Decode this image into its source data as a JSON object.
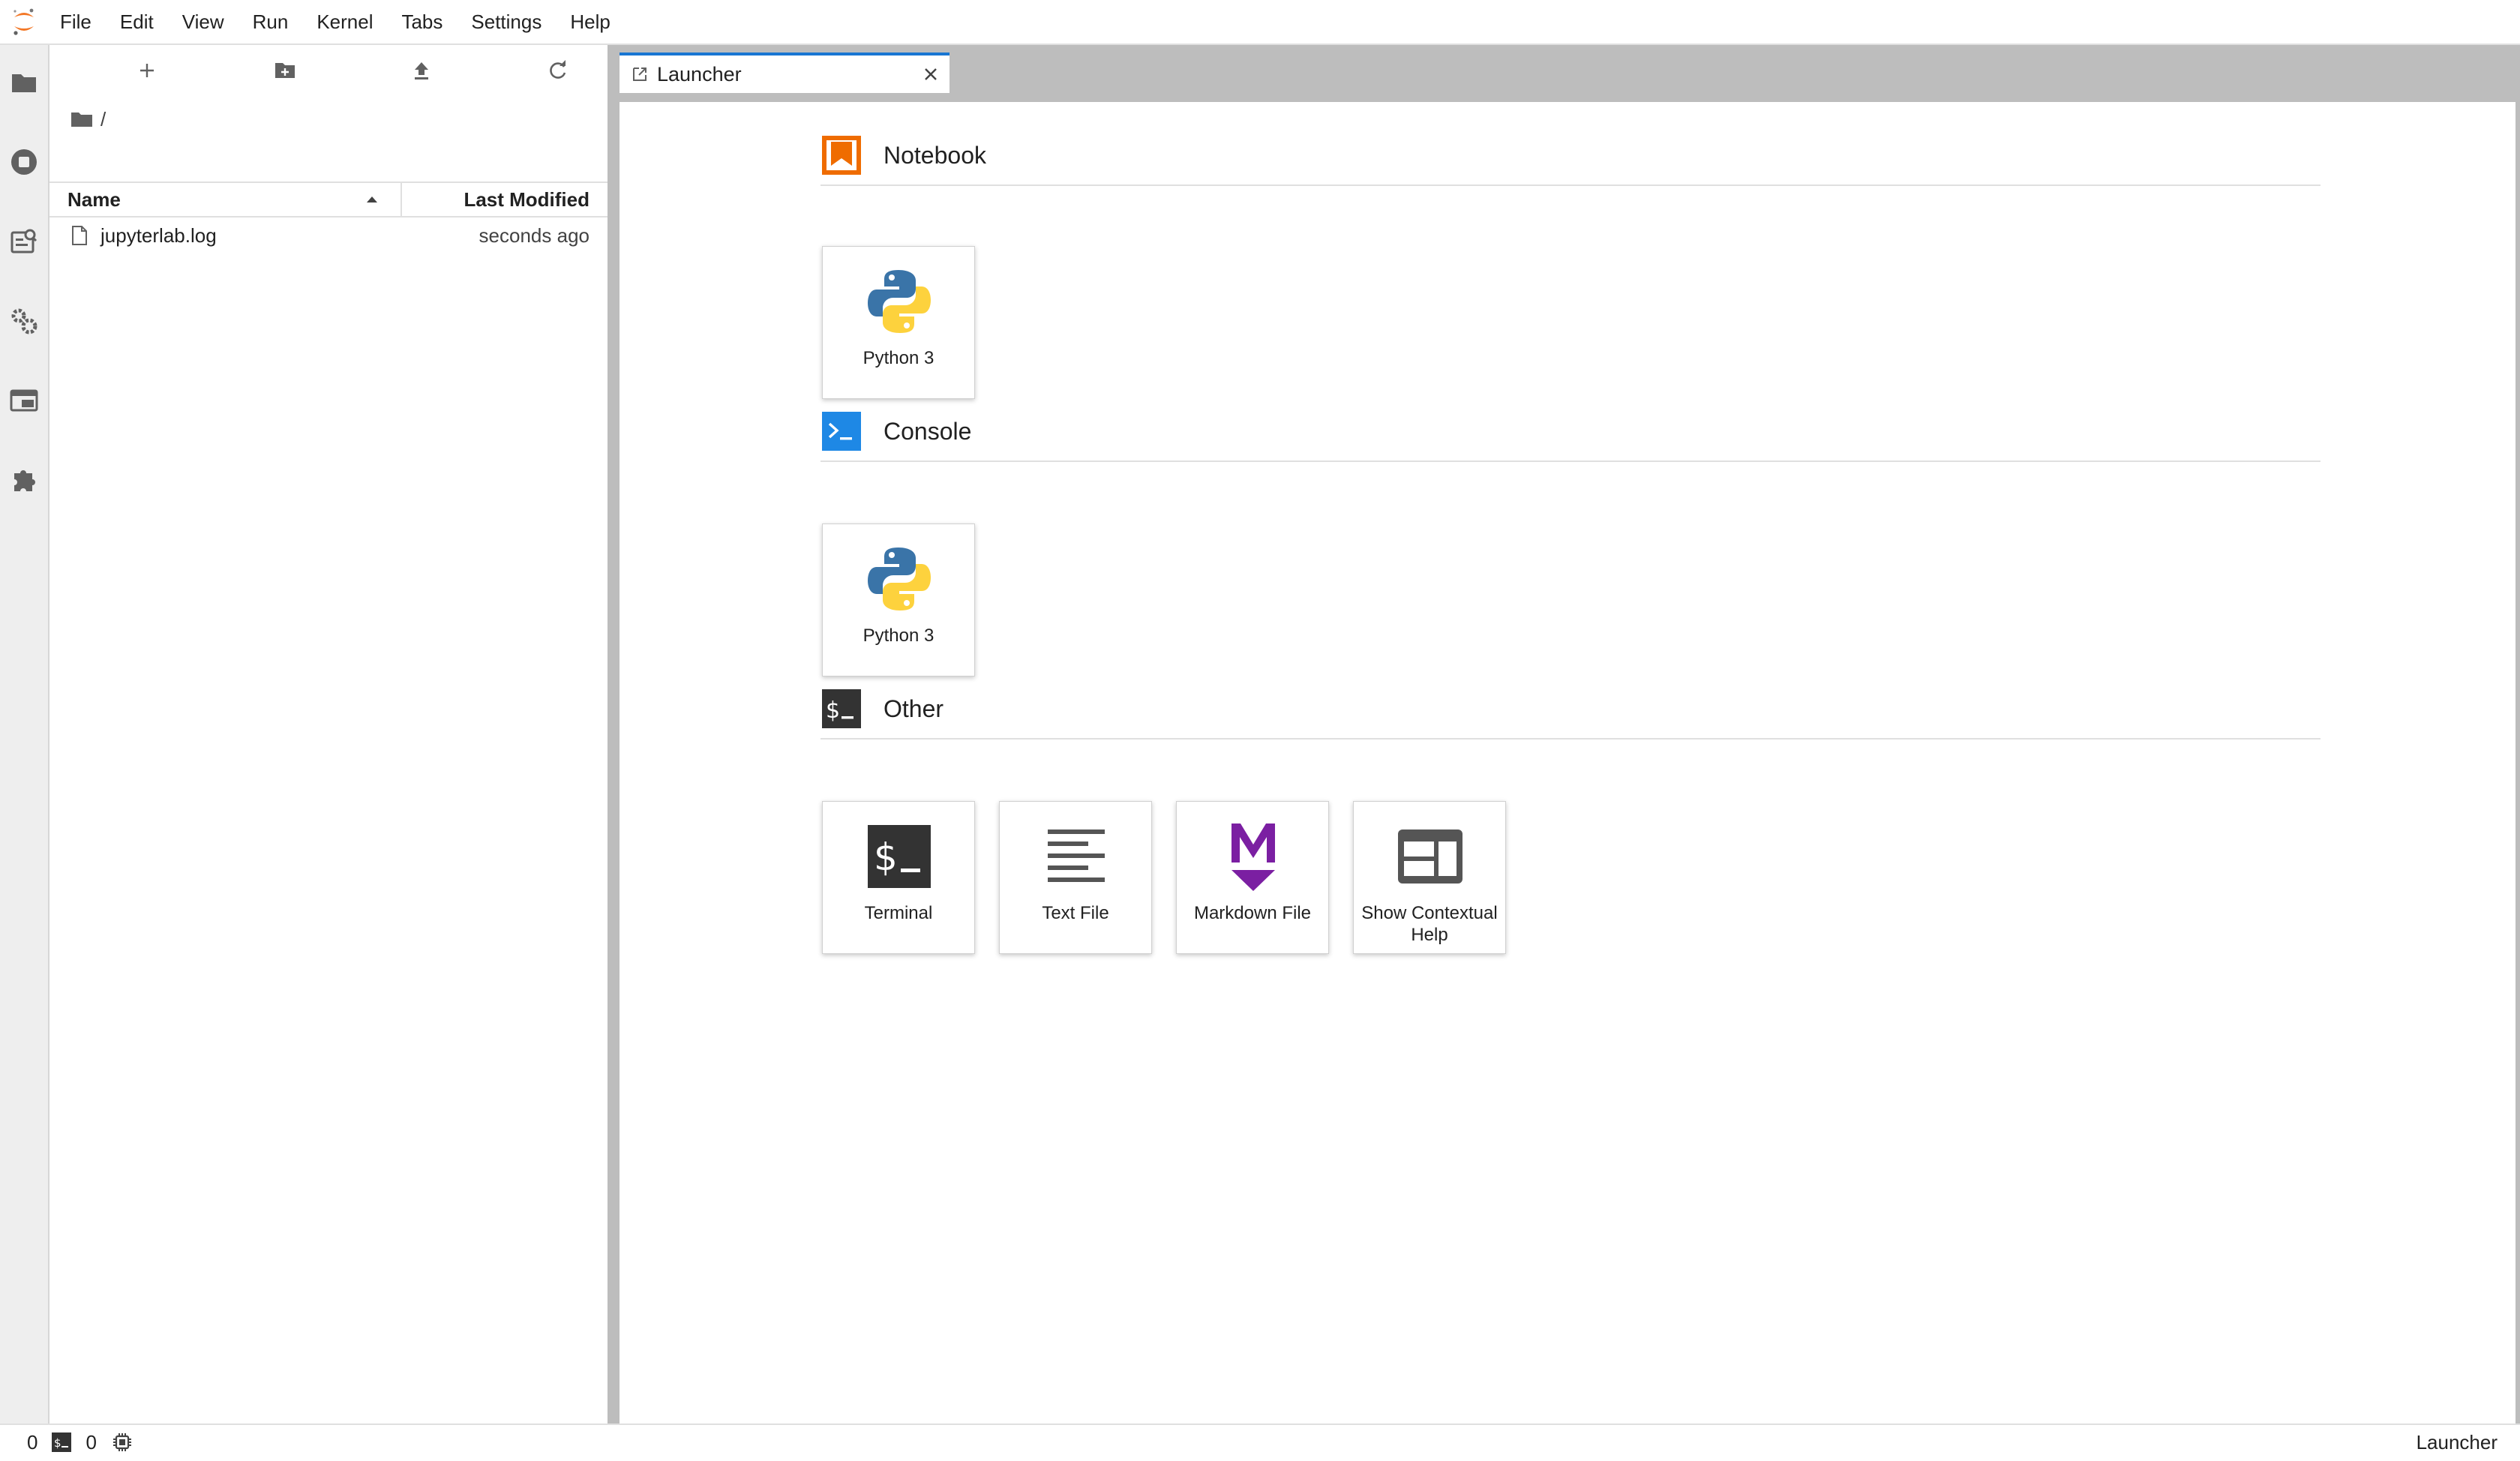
{
  "menu": [
    "File",
    "Edit",
    "View",
    "Run",
    "Kernel",
    "Tabs",
    "Settings",
    "Help"
  ],
  "activity_bar": [
    "folder-icon",
    "running-icon",
    "command-palette-icon",
    "property-inspector-icon",
    "tabs-icon",
    "extension-icon"
  ],
  "file_browser": {
    "toolbar": [
      "new-launcher-icon",
      "new-folder-icon",
      "upload-icon",
      "refresh-icon"
    ],
    "breadcrumb": "/",
    "columns": {
      "name": "Name",
      "modified": "Last Modified"
    },
    "files": [
      {
        "name": "jupyterlab.log",
        "modified": "seconds ago"
      }
    ]
  },
  "tabs": [
    {
      "label": "Launcher",
      "active": true
    }
  ],
  "launcher": {
    "sections": [
      {
        "title": "Notebook",
        "cards": [
          {
            "label": "Python 3",
            "icon": "python-icon"
          }
        ]
      },
      {
        "title": "Console",
        "cards": [
          {
            "label": "Python 3",
            "icon": "python-icon"
          }
        ]
      },
      {
        "title": "Other",
        "cards": [
          {
            "label": "Terminal",
            "icon": "terminal-icon"
          },
          {
            "label": "Text File",
            "icon": "text-file-icon"
          },
          {
            "label": "Markdown File",
            "icon": "markdown-icon"
          },
          {
            "label": "Show Contextual Help",
            "icon": "contextual-help-icon"
          }
        ]
      }
    ]
  },
  "status_bar": {
    "kernels_count": "0",
    "terminals_count": "0",
    "current_activity": "Launcher"
  },
  "colors": {
    "accent": "#1976d2",
    "notebook": "#ef6c00",
    "console": "#1e88e5",
    "markdown": "#7b1fa2",
    "python_blue": "#3a74a8",
    "python_yellow": "#fdd23d"
  }
}
